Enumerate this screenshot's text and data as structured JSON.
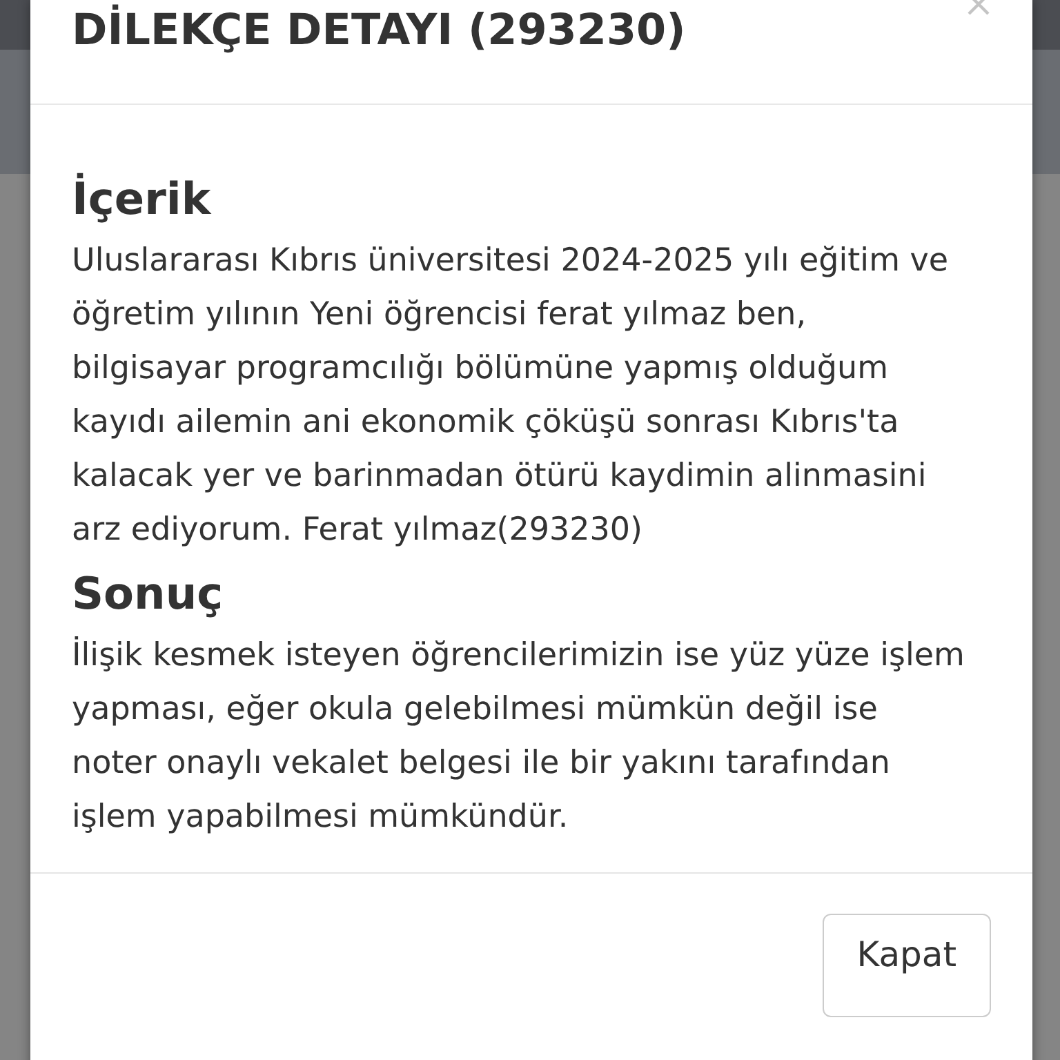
{
  "modal": {
    "title": "DİLEKÇE DETAYI (293230)",
    "sections": [
      {
        "heading": "İçerik",
        "text": "Uluslararası Kıbrıs üniversitesi 2024-2025 yılı eğitim ve öğretim yılının Yeni öğrencisi ferat yılmaz ben, bilgisayar programcılığı bölümüne yapmış olduğum kayıdı ailemin ani ekonomik çöküşü sonrası Kıbrıs'ta kalacak yer ve barinmadan ötürü kaydimin alinmasini arz ediyorum. Ferat yılmaz(293230)"
      },
      {
        "heading": "Sonuç",
        "text": "İlişik kesmek isteyen öğrencilerimizin ise yüz yüze işlem yapması, eğer okula gelebilmesi mümkün değil ise noter onaylı vekalet belgesi ile bir yakını tarafından işlem yapabilmesi mümkündür."
      }
    ],
    "footer_buttons": [
      "Kapat"
    ]
  }
}
